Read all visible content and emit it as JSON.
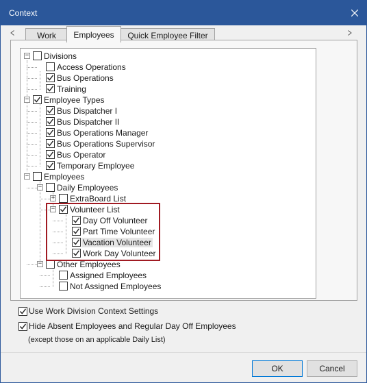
{
  "window": {
    "title": "Context"
  },
  "tabs": [
    {
      "label": "Work",
      "active": false
    },
    {
      "label": "Employees",
      "active": true
    },
    {
      "label": "Quick Employee Filter",
      "active": false
    }
  ],
  "tree": [
    {
      "id": "divisions",
      "label": "Divisions",
      "checked": false,
      "expander": "minus"
    },
    {
      "id": "access-operations",
      "label": "Access Operations",
      "checked": false
    },
    {
      "id": "bus-operations",
      "label": "Bus Operations",
      "checked": true
    },
    {
      "id": "training",
      "label": "Training",
      "checked": true
    },
    {
      "id": "employee-types",
      "label": "Employee Types",
      "checked": true,
      "expander": "minus"
    },
    {
      "id": "bus-dispatcher-i",
      "label": "Bus Dispatcher I",
      "checked": true
    },
    {
      "id": "bus-dispatcher-ii",
      "label": "Bus Dispatcher II",
      "checked": true
    },
    {
      "id": "bus-operations-manager",
      "label": "Bus Operations Manager",
      "checked": true
    },
    {
      "id": "bus-operations-supervisor",
      "label": "Bus Operations Supervisor",
      "checked": true
    },
    {
      "id": "bus-operator",
      "label": "Bus Operator",
      "checked": true
    },
    {
      "id": "temporary-employee",
      "label": "Temporary Employee",
      "checked": true
    },
    {
      "id": "employees",
      "label": "Employees",
      "checked": false,
      "expander": "minus"
    },
    {
      "id": "daily-employees",
      "label": "Daily Employees",
      "checked": false,
      "expander": "minus"
    },
    {
      "id": "extraboard-list",
      "label": "ExtraBoard List",
      "checked": false,
      "expander": "plus"
    },
    {
      "id": "volunteer-list",
      "label": "Volunteer List",
      "checked": true,
      "expander": "minus"
    },
    {
      "id": "day-off-volunteer",
      "label": "Day Off Volunteer",
      "checked": true
    },
    {
      "id": "part-time-volunteer",
      "label": "Part Time Volunteer",
      "checked": true
    },
    {
      "id": "vacation-volunteer",
      "label": "Vacation Volunteer",
      "checked": true,
      "selected": true
    },
    {
      "id": "work-day-volunteer",
      "label": "Work Day Volunteer",
      "checked": true
    },
    {
      "id": "other-employees",
      "label": "Other Employees",
      "checked": false,
      "expander": "minus"
    },
    {
      "id": "assigned-employees",
      "label": "Assigned Employees",
      "checked": false
    },
    {
      "id": "not-assigned-employees",
      "label": "Not Assigned Employees",
      "checked": false
    }
  ],
  "options": {
    "work_division": {
      "label": "Use Work Division Context Settings",
      "checked": true
    },
    "hide_absent": {
      "label": "Hide Absent Employees and Regular Day Off Employees",
      "checked": true
    },
    "note": "(except those on an applicable Daily List)"
  },
  "buttons": {
    "ok": "OK",
    "cancel": "Cancel"
  },
  "colors": {
    "titlebar": "#2b579a",
    "highlight": "#a01a22"
  }
}
